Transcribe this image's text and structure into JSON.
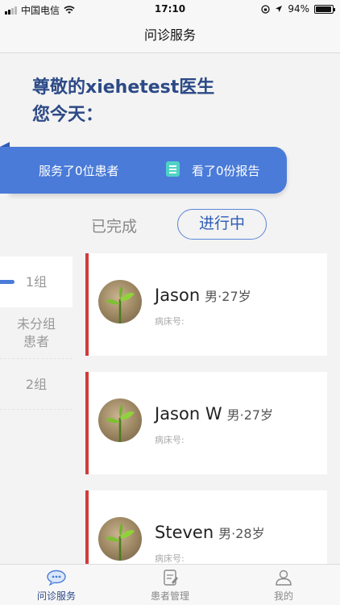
{
  "status_bar": {
    "carrier": "中国电信",
    "time": "17:10",
    "battery": "94%"
  },
  "nav": {
    "title": "问诊服务"
  },
  "greeting": {
    "line1": "尊敬的xiehetest医生",
    "line2": "您今天："
  },
  "summary": {
    "served": "服务了0位患者",
    "viewed": "看了0份报告"
  },
  "tabs": {
    "done": "已完成",
    "in_progress": "进行中"
  },
  "groups": [
    {
      "label": "1组"
    },
    {
      "label_line1": "未分组",
      "label_line2": "患者"
    },
    {
      "label": "2组"
    }
  ],
  "patients": [
    {
      "name": "Jason",
      "meta": "男·27岁",
      "bed": "病床号:"
    },
    {
      "name": "Jason W",
      "meta": "男·27岁",
      "bed": "病床号:"
    },
    {
      "name": "Steven",
      "meta": "男·28岁",
      "bed": "病床号:"
    }
  ],
  "tab_bar": {
    "consult": "问诊服务",
    "patients": "患者管理",
    "mine": "我的"
  },
  "colors": {
    "accent": "#4a7bd8",
    "card_border": "#d23a3a",
    "report_icon": "#4fd2c6"
  }
}
